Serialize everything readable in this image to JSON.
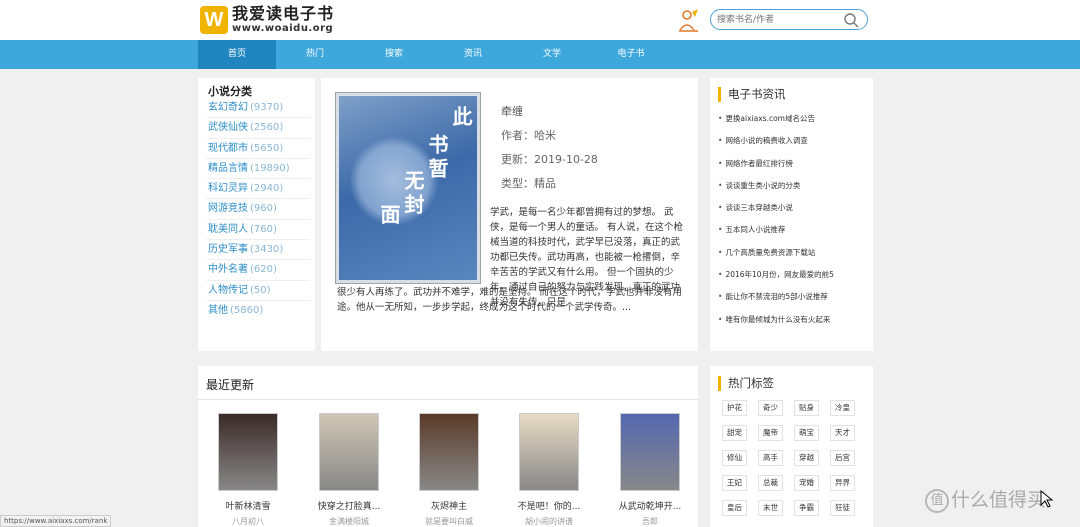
{
  "site": {
    "logo_glyph": "W",
    "title": "我爱读电子书",
    "url": "www.woaidu.org"
  },
  "search": {
    "placeholder": "搜索书名/作者"
  },
  "nav": [
    {
      "label": "首页",
      "active": true
    },
    {
      "label": "热门"
    },
    {
      "label": "搜索"
    },
    {
      "label": "资讯"
    },
    {
      "label": "文学"
    },
    {
      "label": "电子书"
    }
  ],
  "categories": {
    "title": "小说分类",
    "items": [
      {
        "name": "玄幻奇幻",
        "count": "(9370)"
      },
      {
        "name": "武侠仙侠",
        "count": "(2560)"
      },
      {
        "name": "现代都市",
        "count": "(5650)"
      },
      {
        "name": "精品言情",
        "count": "(19890)"
      },
      {
        "name": "科幻灵异",
        "count": "(2940)"
      },
      {
        "name": "网游竞技",
        "count": "(960)"
      },
      {
        "name": "耽美同人",
        "count": "(760)"
      },
      {
        "name": "历史军事",
        "count": "(3430)"
      },
      {
        "name": "中外名著",
        "count": "(620)"
      },
      {
        "name": "人物传记",
        "count": "(50)"
      },
      {
        "name": "其他",
        "count": "(5860)"
      }
    ]
  },
  "featured": {
    "cover_text": [
      "此",
      "书暂",
      "无封",
      "面"
    ],
    "name": "牵缠",
    "author": "作者：哈米",
    "updated": "更新：2019-10-28",
    "type": "类型：精品",
    "desc_right": "学武，是每一名少年都曾拥有过的梦想。 武侠，是每一个男人的童话。 有人说，在这个枪械当道的科技时代，武学早已没落，真正的武功都已失传。武功再高，也能被一枪撂倒，辛辛苦苦的学武又有什么用。 但一个固执的少年，通过自己的努力与实践发现，真正的武功并没有失传，只是",
    "desc_bottom": "很少有人再练了。武功并不难学，难的是坚持。 而在这个时代，学武也并非没有用途。他从一无所知，一步步学起，终成为这个时代的一个武学传奇。..."
  },
  "news": {
    "title": "电子书资讯",
    "items": [
      "更换aixiaxs.com域名公告",
      "网络小说的稿费收入调查",
      "网络作者最红排行榜",
      "谈谈重生类小说的分类",
      "谈谈三本穿越类小说",
      "五本同人小说推荐",
      "几个高质量免费资源下载站",
      "2016年10月份，网友最爱的前5",
      "能让你不禁流泪的5部小说推荐",
      "唯有你最倾城为什么没有火起来"
    ]
  },
  "recent": {
    "title": "最近更新",
    "books": [
      {
        "name": "叶新林清雪",
        "author": "八月初八",
        "color": "#3a2a28"
      },
      {
        "name": "快穿之打脸真...",
        "author": "金满楼阳城",
        "color": "#cfc7b5"
      },
      {
        "name": "灰烬神主",
        "author": "就是要叫白威",
        "color": "#5a3a28"
      },
      {
        "name": "不是吧！你的...",
        "author": "胡小闹的讲谱",
        "color": "#e8dcc6"
      },
      {
        "name": "从武动乾坤开...",
        "author": "吾郎",
        "color": "#5468b0"
      }
    ]
  },
  "tags": {
    "title": "热门标签",
    "items": [
      "护花",
      "奇少",
      "贴身",
      "冷皇",
      "甜宠",
      "魔帝",
      "萌宝",
      "天才",
      "修仙",
      "高手",
      "穿越",
      "后宫",
      "王妃",
      "总裁",
      "宠婚",
      "异界",
      "皇后",
      "末世",
      "争霸",
      "狂徒"
    ]
  },
  "status_url": "https://www.aixiaxs.com/rank",
  "watermark": "什么值得买",
  "watermark_badge": "值"
}
